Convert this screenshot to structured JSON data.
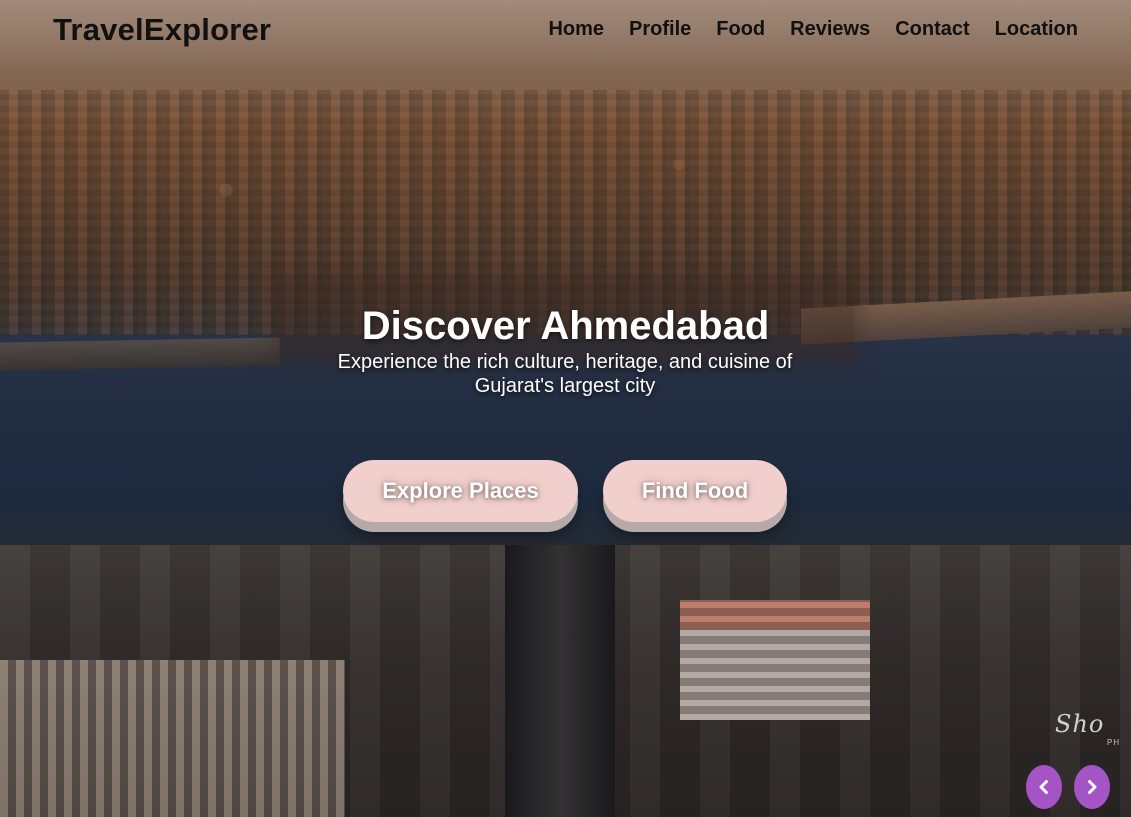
{
  "navbar": {
    "brand": "TravelExplorer",
    "links": [
      "Home",
      "Profile",
      "Food",
      "Reviews",
      "Contact",
      "Location"
    ]
  },
  "hero": {
    "title": "Discover Ahmedabad",
    "subtitle": "Experience the rich culture, heritage, and cuisine of Gujarat's largest city",
    "buttons": {
      "explore_label": "Explore Places",
      "food_label": "Find Food"
    }
  },
  "carousel": {
    "prev_icon": "chevron-left-icon",
    "next_icon": "chevron-right-icon"
  },
  "colors": {
    "brand_text": "#111111",
    "button_bg": "#f1cfcc",
    "carousel_button": "#a454c4"
  }
}
